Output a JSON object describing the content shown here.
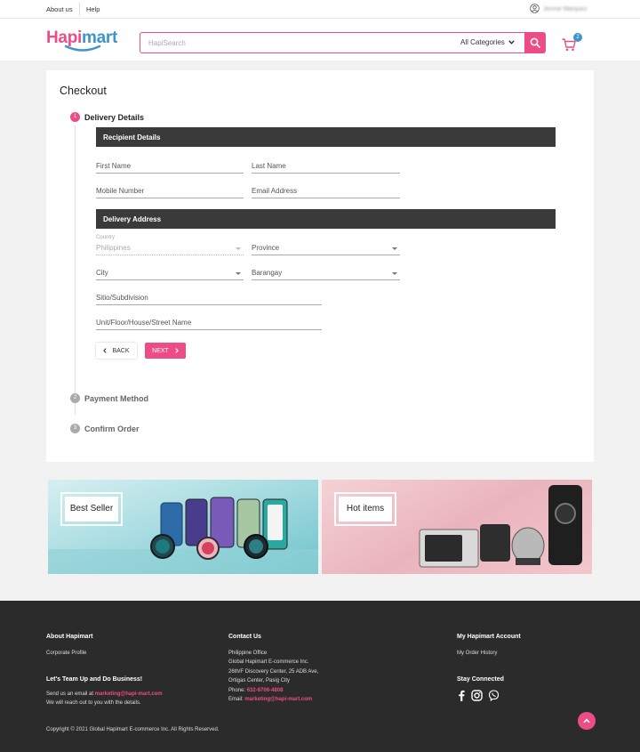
{
  "topbar": {
    "about": "About us",
    "help": "Help",
    "user_name": "Jennie Marquez"
  },
  "header": {
    "logo_text_1": "Hapi",
    "logo_text_2": "mart",
    "search_placeholder": "HapiSearch",
    "category": "All Categories",
    "cart_count": "2"
  },
  "checkout": {
    "title": "Checkout",
    "steps": [
      {
        "num": "1",
        "label": "Delivery Details"
      },
      {
        "num": "2",
        "label": "Payment Method"
      },
      {
        "num": "3",
        "label": "Confirm Order"
      }
    ],
    "recipient": {
      "header": "Recipient Details",
      "first_name": "First Name",
      "last_name": "Last Name",
      "mobile": "Mobile Number",
      "email": "Email Address"
    },
    "address": {
      "header": "Delivery Address",
      "country_label": "Country",
      "country_value": "Philippines",
      "province": "Province",
      "city": "City",
      "barangay": "Barangay",
      "sitio": "Sitio/Subdivision",
      "unit": "Unit/Floor/House/Street Name"
    },
    "back": "BACK",
    "next": "NEXT"
  },
  "banners": [
    {
      "label": "Best Seller"
    },
    {
      "label": "Hot items"
    }
  ],
  "footer": {
    "about": {
      "heading": "About Hapimart",
      "link": "Corporate Profile"
    },
    "team": {
      "heading": "Let's Team Up and Do Business!",
      "line1": "Send us an email at",
      "email": "marketing@hapi-mart.com",
      "line2": "We will reach out to you with the details."
    },
    "contact": {
      "heading": "Contact Us",
      "office": "Philippine Office",
      "addr1": "Global Hapimart E-commerce Inc.",
      "addr2": "26th/F Discovery Center, 25 ADB Ave,",
      "addr3": "Ortigas Center, Pasig City",
      "phone_label": "Phone:",
      "phone": "632-8706-4808",
      "email_label": "Email:",
      "email": "marketing@hapi-mart.com"
    },
    "account": {
      "heading": "My Hapimart Account",
      "link": "My Order History",
      "stay": "Stay Connected"
    },
    "copyright": "Copyright © 2021 Global Hapimart E-commerce Inc. All Rights Reserved."
  },
  "colors": {
    "brand_pink": "#ec4d85",
    "brand_blue": "#3d95c9",
    "dark_bar": "#3a3a3a",
    "footer_bg": "#2b2b2b"
  }
}
